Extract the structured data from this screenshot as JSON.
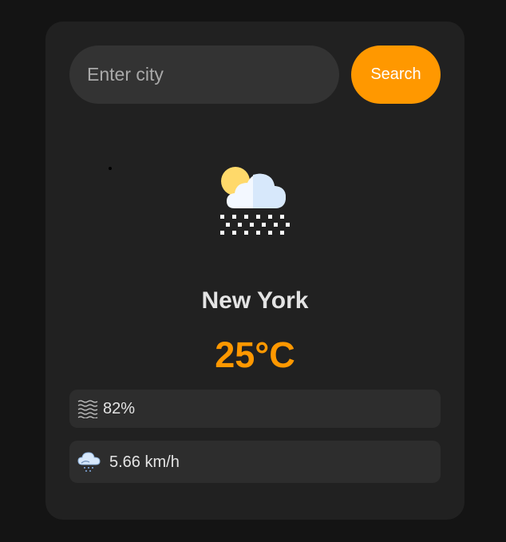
{
  "search": {
    "placeholder": "Enter city",
    "button_label": "Search"
  },
  "weather": {
    "icon": "cloud-sun-snow-icon",
    "city": "New York",
    "temperature": "25°C",
    "humidity": {
      "icon": "humidity-waves-icon",
      "value": "82%"
    },
    "wind": {
      "icon": "wind-cloud-icon",
      "value": "5.66 km/h"
    }
  },
  "colors": {
    "accent": "#ff9800",
    "background": "#141414",
    "card": "#212121"
  }
}
